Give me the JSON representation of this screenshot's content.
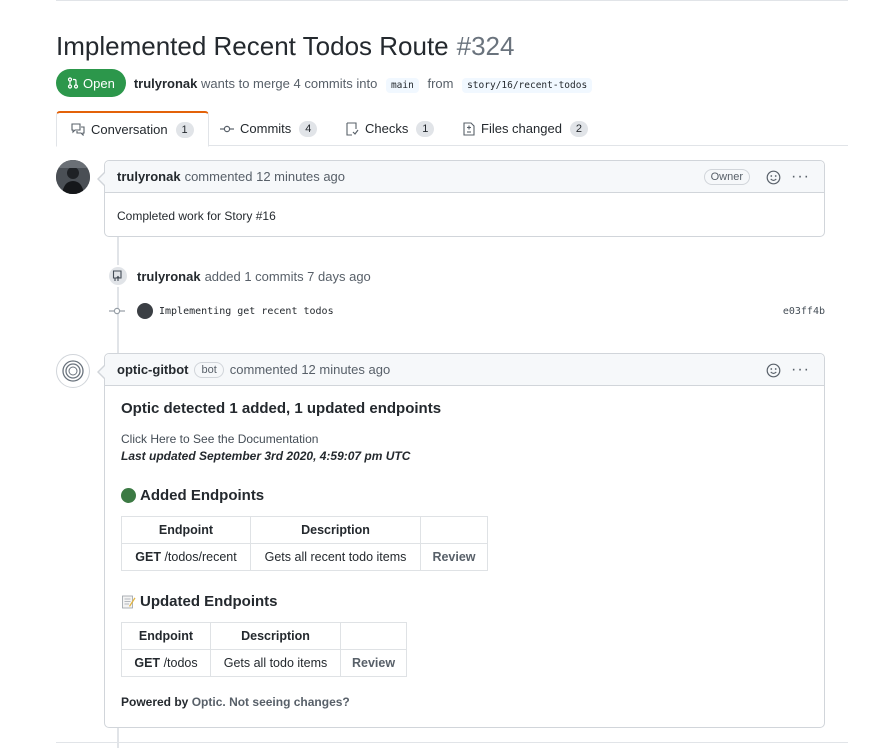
{
  "pr": {
    "title": "Implemented Recent Todos Route",
    "number": "#324",
    "state": "Open",
    "author": "trulyronak",
    "merge_text": "wants to merge 4 commits into",
    "base_branch": "main",
    "from_text": "from",
    "head_branch": "story/16/recent-todos"
  },
  "tabs": [
    {
      "label": "Conversation",
      "count": "1"
    },
    {
      "label": "Commits",
      "count": "4"
    },
    {
      "label": "Checks",
      "count": "1"
    },
    {
      "label": "Files changed",
      "count": "2"
    }
  ],
  "comment1": {
    "author": "trulyronak",
    "action": "commented 12 minutes ago",
    "role": "Owner",
    "body": "Completed work for Story #16"
  },
  "event": {
    "author": "trulyronak",
    "text": "added 1 commits 7 days ago"
  },
  "commit": {
    "message": "Implementing get recent todos",
    "sha": "e03ff4b"
  },
  "comment2": {
    "author": "optic-gitbot",
    "badge": "bot",
    "action": "commented 12 minutes ago",
    "heading": "Optic detected 1 added, 1 updated endpoints",
    "doc_link": "Click Here to See the Documentation",
    "last_updated": "Last updated September 3rd 2020, 4:59:07 pm UTC",
    "added_title": "Added Endpoints",
    "updated_title": "Updated Endpoints",
    "table_headers": [
      "Endpoint",
      "Description"
    ],
    "added_rows": [
      {
        "method": "GET",
        "path": "/todos/recent",
        "description": "Gets all recent todo items",
        "action": "Review"
      }
    ],
    "updated_rows": [
      {
        "method": "GET",
        "path": "/todos",
        "description": "Gets all todo items",
        "action": "Review"
      }
    ],
    "powered_prefix": "Powered by",
    "powered_link": "Optic.",
    "not_seeing": "Not seeing changes?"
  },
  "colors": {
    "open_green": "#2c974b",
    "tab_accent": "#e36209",
    "added_dot": "#3c7a44"
  }
}
